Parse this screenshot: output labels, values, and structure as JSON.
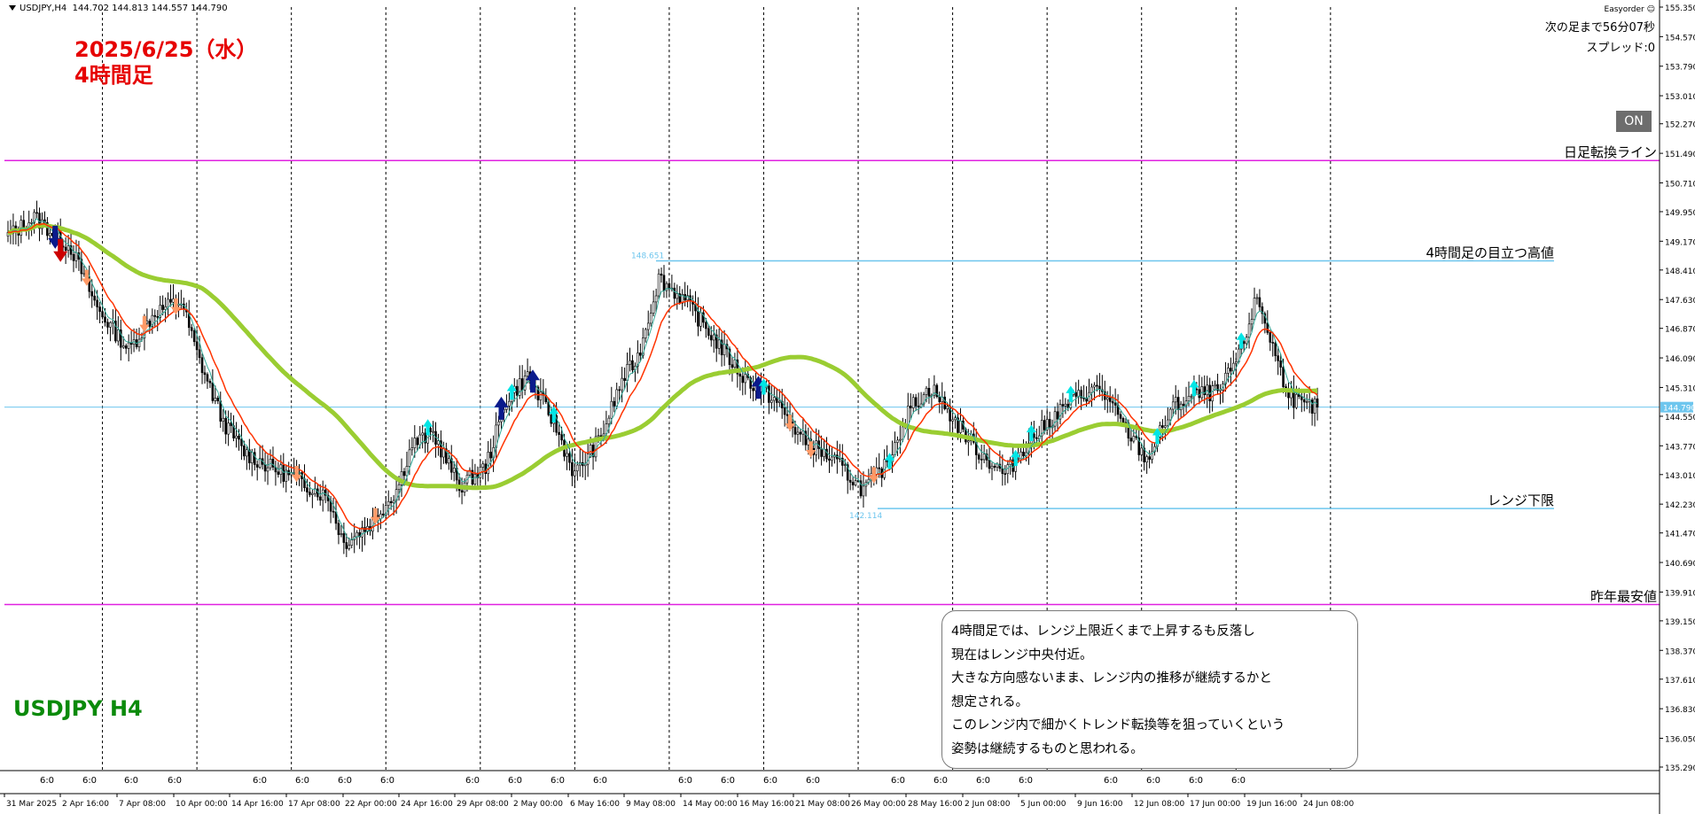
{
  "chart_info": {
    "symbol_label": "USDJPY,H4",
    "ohlc": "144.702 144.813 144.557 144.790"
  },
  "overlay": {
    "date_line": "2025/6/25（水）",
    "timeframe_line": "4時間足",
    "symbol_title": "USDJPY H4"
  },
  "ea_panel": {
    "name": "Easyorder",
    "countdown": "次の足まで56分07秒",
    "spread": "スプレッド:0",
    "toggle_label": "ON"
  },
  "comment": {
    "lines": [
      "4時間足では、レンジ上限近くまで上昇するも反落し",
      "現在はレンジ中央付近。",
      "大きな方向感ないまま、レンジ内の推移が継続するかと",
      "想定される。",
      "このレンジ内で細かくトレンド転換等を狙っていくという",
      "姿勢は継続するものと思われる。"
    ]
  },
  "colors": {
    "candle": "#000000",
    "daily_line": "#e020e0",
    "range_line": "#6ec6ee",
    "ma_long": "#9acd32",
    "ma_short_red": "#ff3300",
    "ma_short_teal": "#33aa99",
    "arrow_up": "#0a1a8c",
    "arrow_down": "#cc0000",
    "arrow_up_light": "#00e5e5",
    "arrow_down_light": "#ff9966",
    "title_red": "#e60000",
    "symbol_green": "#0a8a0a"
  },
  "chart_data": {
    "type": "candlestick",
    "y_range": [
      135.29,
      155.35
    ],
    "y_ticks": [
      "155.350",
      "154.570",
      "153.790",
      "153.010",
      "152.270",
      "151.490",
      "150.710",
      "149.950",
      "149.170",
      "148.410",
      "147.630",
      "146.870",
      "146.090",
      "145.310",
      "144.550",
      "143.770",
      "143.010",
      "142.230",
      "141.470",
      "140.690",
      "139.910",
      "139.150",
      "138.370",
      "137.610",
      "136.830",
      "136.050",
      "135.290"
    ],
    "current_price": "144.790",
    "x_labels": [
      "31 Mar 2025",
      "2 Apr 16:00",
      "7 Apr 08:00",
      "10 Apr 00:00",
      "14 Apr 16:00",
      "17 Apr 08:00",
      "22 Apr 00:00",
      "24 Apr 16:00",
      "29 Apr 08:00",
      "2 May 00:00",
      "6 May 16:00",
      "9 May 08:00",
      "14 May 00:00",
      "16 May 16:00",
      "21 May 08:00",
      "26 May 00:00",
      "28 May 16:00",
      "2 Jun 08:00",
      "5 Jun 00:00",
      "9 Jun 16:00",
      "12 Jun 08:00",
      "17 Jun 00:00",
      "19 Jun 16:00",
      "24 Jun 08:00"
    ],
    "session_label": "6:0",
    "horizontal_lines": [
      {
        "label": "日足転換ライン",
        "price": 151.3
      },
      {
        "label": "4時間足の目立つ高値",
        "price": 148.651
      },
      {
        "label": "レンジ下限",
        "price": 142.114
      },
      {
        "label": "昨年最安値",
        "price": 139.58
      }
    ],
    "high_marker": "148.651",
    "low_marker": "142.114",
    "anchors": [
      [
        0,
        149.3
      ],
      [
        10,
        149.8
      ],
      [
        24,
        149.0
      ],
      [
        34,
        147.4
      ],
      [
        46,
        146.3
      ],
      [
        56,
        147.3
      ],
      [
        66,
        147.6
      ],
      [
        72,
        146.2
      ],
      [
        82,
        144.4
      ],
      [
        90,
        143.6
      ],
      [
        100,
        143.2
      ],
      [
        110,
        142.9
      ],
      [
        122,
        142.4
      ],
      [
        128,
        141.2
      ],
      [
        138,
        141.7
      ],
      [
        148,
        142.6
      ],
      [
        154,
        143.8
      ],
      [
        162,
        144.1
      ],
      [
        172,
        142.7
      ],
      [
        182,
        143.2
      ],
      [
        190,
        145.0
      ],
      [
        198,
        145.6
      ],
      [
        208,
        144.4
      ],
      [
        216,
        143.0
      ],
      [
        226,
        144.0
      ],
      [
        234,
        145.5
      ],
      [
        240,
        146.1
      ],
      [
        248,
        148.2
      ],
      [
        258,
        147.6
      ],
      [
        268,
        146.7
      ],
      [
        280,
        145.6
      ],
      [
        292,
        145.0
      ],
      [
        302,
        144.0
      ],
      [
        316,
        143.3
      ],
      [
        326,
        142.6
      ],
      [
        334,
        143.2
      ],
      [
        344,
        144.8
      ],
      [
        352,
        145.3
      ],
      [
        360,
        144.5
      ],
      [
        370,
        143.6
      ],
      [
        380,
        143.0
      ],
      [
        388,
        143.8
      ],
      [
        398,
        144.5
      ],
      [
        406,
        145.0
      ],
      [
        416,
        145.3
      ],
      [
        426,
        144.2
      ],
      [
        434,
        143.4
      ],
      [
        444,
        144.8
      ],
      [
        452,
        145.1
      ],
      [
        462,
        145.2
      ],
      [
        470,
        146.3
      ],
      [
        476,
        147.7
      ],
      [
        482,
        146.4
      ],
      [
        486,
        145.5
      ],
      [
        490,
        145.0
      ],
      [
        494,
        144.79
      ]
    ]
  }
}
